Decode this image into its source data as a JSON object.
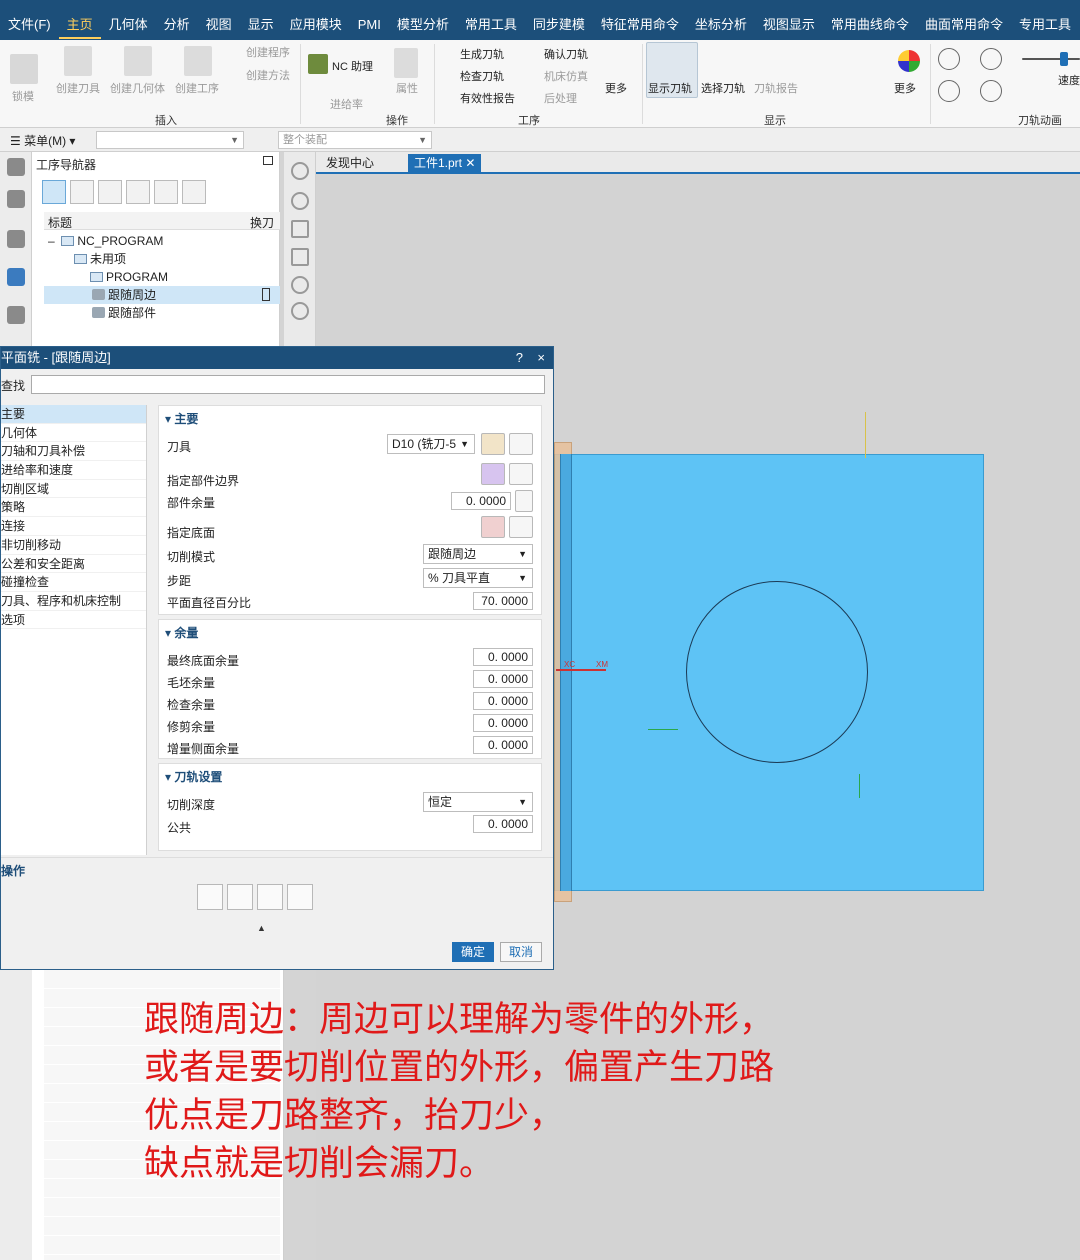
{
  "app": {
    "logo": "NX"
  },
  "menu": [
    "文件(F)",
    "主页",
    "几何体",
    "分析",
    "视图",
    "显示",
    "应用模块",
    "PMI",
    "模型分析",
    "常用工具",
    "同步建模",
    "特征常用命令",
    "坐标分析",
    "视图显示",
    "常用曲线命令",
    "曲面常用命令",
    "专用工具"
  ],
  "ribbon": {
    "tools": [
      "锁模",
      "创建刀具",
      "创建几何体",
      "创建工序",
      "创建程序",
      "创建方法",
      "NC 助理",
      "进给率",
      "属性",
      "生成刀轨",
      "确认刀轨",
      "检查刀轨",
      "机床仿真",
      "有效性报告",
      "后处理",
      "更多",
      "显示刀轨",
      "选择刀轨",
      "刀轨报告",
      "更多",
      "速度"
    ],
    "groups": [
      "插入",
      "操作",
      "工序",
      "显示",
      "刀轨动画"
    ]
  },
  "toolbar": {
    "menu_label": "菜单(M)",
    "assembly_placeholder": "整个装配"
  },
  "navigator": {
    "title": "工序导航器",
    "columns": [
      "标题",
      "换刀"
    ],
    "rows": [
      {
        "label": "NC_PROGRAM",
        "kind": "folder"
      },
      {
        "label": "未用项",
        "kind": "folder"
      },
      {
        "label": "PROGRAM",
        "kind": "folder"
      },
      {
        "label": "跟随周边",
        "kind": "op"
      },
      {
        "label": "跟随部件",
        "kind": "op"
      }
    ]
  },
  "tabs": [
    "发现中心",
    "工件1.prt"
  ],
  "viewport": {
    "axis_x": "XC",
    "axis_xm": "XM"
  },
  "dialog": {
    "title": "平面铣 - [跟随周边]",
    "help": "?",
    "close": "×",
    "search_label": "查找",
    "nav_items": [
      "主要",
      "几何体",
      "刀轴和刀具补偿",
      "进给率和速度",
      "切削区域",
      "策略",
      "连接",
      "非切削移动",
      "公差和安全距离",
      "碰撞检查",
      "刀具、程序和机床控制",
      "选项"
    ],
    "main": {
      "header": "主要",
      "tool_label": "刀具",
      "tool_value": "D10 (铣刀-5",
      "boundary_label": "指定部件边界",
      "part_stock_label": "部件余量",
      "part_stock_value": "0. 0000",
      "floor_label": "指定底面",
      "cut_pattern_label": "切削模式",
      "cut_pattern_value": "跟随周边",
      "stepover_label": "步距",
      "stepover_value": "% 刀具平直",
      "flat_pct_label": "平面直径百分比",
      "flat_pct_value": "70. 0000"
    },
    "stock": {
      "header": "余量",
      "rows": [
        {
          "label": "最终底面余量",
          "value": "0. 0000"
        },
        {
          "label": "毛坯余量",
          "value": "0. 0000"
        },
        {
          "label": "检查余量",
          "value": "0. 0000"
        },
        {
          "label": "修剪余量",
          "value": "0. 0000"
        },
        {
          "label": "增量侧面余量",
          "value": "0. 0000"
        }
      ]
    },
    "path": {
      "header": "刀轨设置",
      "depth_label": "切削深度",
      "depth_value": "恒定",
      "common_label": "公共",
      "common_value": "0. 0000"
    },
    "ops_label": "操作",
    "ok": "确定",
    "cancel": "取消"
  },
  "caption": {
    "line1": "跟随周边：周边可以理解为零件的外形，",
    "line2": "或者是要切削位置的外形，偏置产生刀路",
    "line3": "优点是刀路整齐，抬刀少，",
    "line4": "缺点就是切削会漏刀。"
  }
}
